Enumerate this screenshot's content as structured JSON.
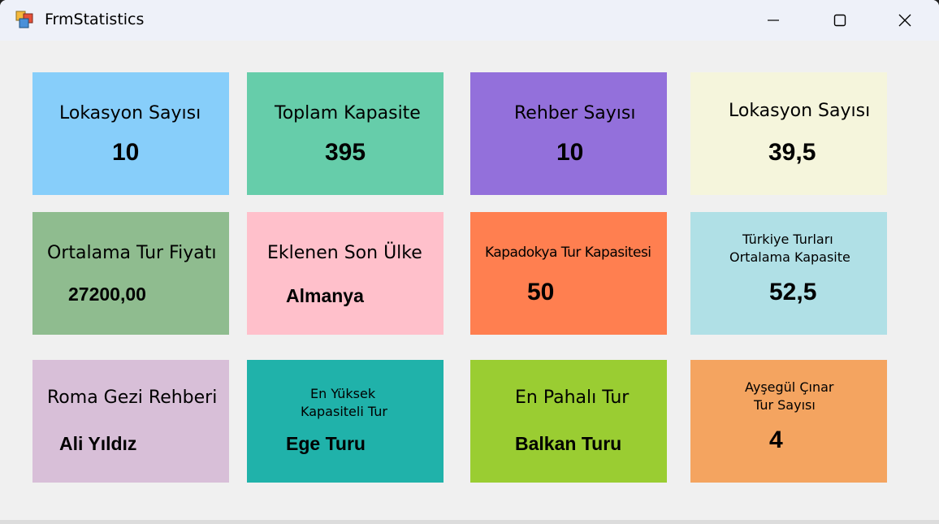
{
  "window": {
    "title": "FrmStatistics"
  },
  "tiles": [
    {
      "label": "Lokasyon Sayısı",
      "value": "10",
      "color": "#87cefa"
    },
    {
      "label": "Toplam Kapasite",
      "value": "395",
      "color": "#66cdaa"
    },
    {
      "label": "Rehber Sayısı",
      "value": "10",
      "color": "#9370db"
    },
    {
      "label": "Lokasyon Sayısı",
      "value": "39,5",
      "color": "#f5f5dc"
    },
    {
      "label": "Ortalama Tur Fiyatı",
      "value": "27200,00",
      "color": "#8fbc8f"
    },
    {
      "label": "Eklenen Son Ülke",
      "value": "Almanya",
      "color": "#ffc0cb"
    },
    {
      "label": "Kapadokya Tur Kapasitesi",
      "value": "50",
      "color": "#ff7f50"
    },
    {
      "label_line1": "Türkiye Turları",
      "label_line2": "Ortalama Kapasite",
      "value": "52,5",
      "color": "#b0e0e6"
    },
    {
      "label": "Roma Gezi Rehberi",
      "value": "Ali Yıldız",
      "color": "#d8bfd8"
    },
    {
      "label_line1": "En Yüksek",
      "label_line2": "Kapasiteli Tur",
      "value": "Ege Turu",
      "color": "#20b2aa"
    },
    {
      "label": "En Pahalı Tur",
      "value": "Balkan Turu",
      "color": "#9acd32"
    },
    {
      "label_line1": "Ayşegül Çınar",
      "label_line2": "Tur Sayısı",
      "value": "4",
      "color": "#f4a460"
    }
  ]
}
